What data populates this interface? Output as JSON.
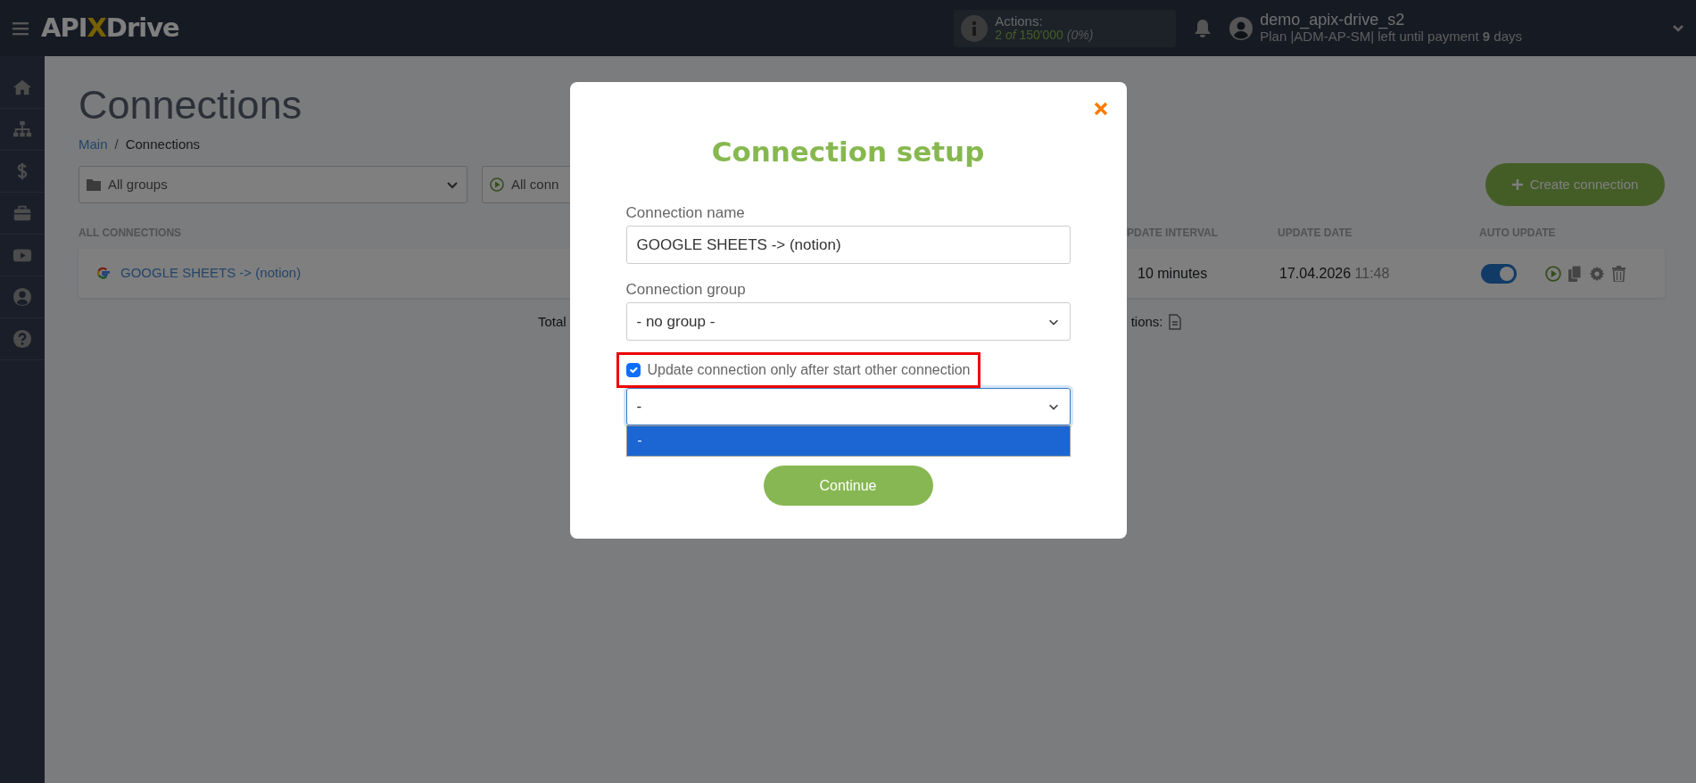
{
  "topbar": {
    "logo": {
      "start": "API",
      "accent": "X",
      "end": "Drive"
    },
    "actions": {
      "label": "Actions:",
      "used": "2",
      "of": "of",
      "total": "150'000",
      "percent": "(0%)"
    },
    "user": {
      "name": "demo_apix-drive_s2",
      "plan": "Plan |ADM-AP-SM| left until payment **9** days"
    }
  },
  "page": {
    "title": "Connections",
    "breadcrumb_separator": "/",
    "breadcrumb": [
      {
        "label": "Main",
        "link": true
      },
      {
        "label": "Connections",
        "link": false
      }
    ],
    "filters": [
      {
        "kind": "group",
        "value": "All groups"
      },
      {
        "kind": "status",
        "value": "All conn"
      }
    ],
    "create_button": "Create connection",
    "table": {
      "columns": [
        "ALL CONNECTIONS",
        "PDATE INTERVAL",
        "UPDATE DATE",
        "AUTO UPDATE"
      ],
      "rows": [
        {
          "name": "GOOGLE SHEETS -> (notion)",
          "interval": "10 minutes",
          "date": "17.04.2026",
          "time": "11:48",
          "auto_update": true
        }
      ]
    },
    "summary": {
      "left": "Total",
      "right": "tions:"
    }
  },
  "modal": {
    "title": "Connection setup",
    "name_field": {
      "label": "Connection name",
      "value": "GOOGLE SHEETS -> (notion)"
    },
    "group_field": {
      "label": "Connection group",
      "value": "- no group -"
    },
    "dependency": {
      "label": "Update connection only after start other connection",
      "checked": true,
      "highlighted": true
    },
    "dependency_select": {
      "value": "-",
      "expanded": true,
      "options": [
        {
          "label": "-",
          "selected": true
        }
      ]
    },
    "continue_button": "Continue"
  }
}
